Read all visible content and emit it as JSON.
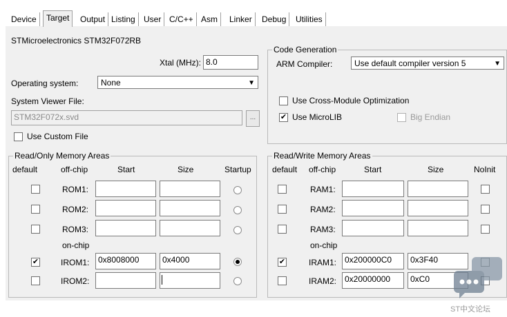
{
  "tabs": [
    "Device",
    "Target",
    "Output",
    "Listing",
    "User",
    "C/C++",
    "Asm",
    "Linker",
    "Debug",
    "Utilities"
  ],
  "device_name": "STMicroelectronics STM32F072RB",
  "xtal": {
    "label": "Xtal (MHz):",
    "value": "8.0"
  },
  "os": {
    "label": "Operating system:",
    "value": "None"
  },
  "svd": {
    "label": "System Viewer File:",
    "value": "STM32F072x.svd",
    "browse": "..."
  },
  "custom_file": {
    "label": "Use Custom File",
    "checked": false
  },
  "codegen": {
    "title": "Code Generation",
    "compiler_label": "ARM Compiler:",
    "compiler_value": "Use default compiler version 5",
    "cross_module": {
      "label": "Use Cross-Module Optimization",
      "checked": false
    },
    "microlib": {
      "label": "Use MicroLIB",
      "checked": true
    },
    "big_endian": {
      "label": "Big Endian",
      "checked": false,
      "disabled": true
    }
  },
  "ro": {
    "title": "Read/Only Memory Areas",
    "headers": {
      "default": "default",
      "offchip": "off-chip",
      "start": "Start",
      "size": "Size",
      "startup": "Startup"
    },
    "onchip_label": "on-chip",
    "rows": [
      {
        "name": "ROM1:",
        "default": false,
        "start": "",
        "size": "",
        "startup": false
      },
      {
        "name": "ROM2:",
        "default": false,
        "start": "",
        "size": "",
        "startup": false
      },
      {
        "name": "ROM3:",
        "default": false,
        "start": "",
        "size": "",
        "startup": false
      },
      {
        "name": "IROM1:",
        "default": true,
        "start": "0x8008000",
        "size": "0x4000",
        "startup": true
      },
      {
        "name": "IROM2:",
        "default": false,
        "start": "",
        "size": "",
        "startup": false
      }
    ]
  },
  "rw": {
    "title": "Read/Write Memory Areas",
    "headers": {
      "default": "default",
      "offchip": "off-chip",
      "start": "Start",
      "size": "Size",
      "noinit": "NoInit"
    },
    "onchip_label": "on-chip",
    "rows": [
      {
        "name": "RAM1:",
        "default": false,
        "start": "",
        "size": "",
        "noinit": false
      },
      {
        "name": "RAM2:",
        "default": false,
        "start": "",
        "size": "",
        "noinit": false
      },
      {
        "name": "RAM3:",
        "default": false,
        "start": "",
        "size": "",
        "noinit": false
      },
      {
        "name": "IRAM1:",
        "default": true,
        "start": "0x200000C0",
        "size": "0x3F40",
        "noinit": false
      },
      {
        "name": "IRAM2:",
        "default": false,
        "start": "0x20000000",
        "size": "0xC0",
        "noinit": false
      }
    ]
  },
  "watermark": "ST中文论坛",
  "check_glyph": "✔",
  "arrow_glyph": "▼",
  "icons": {
    "watermark": "chat-bubble-icon"
  }
}
